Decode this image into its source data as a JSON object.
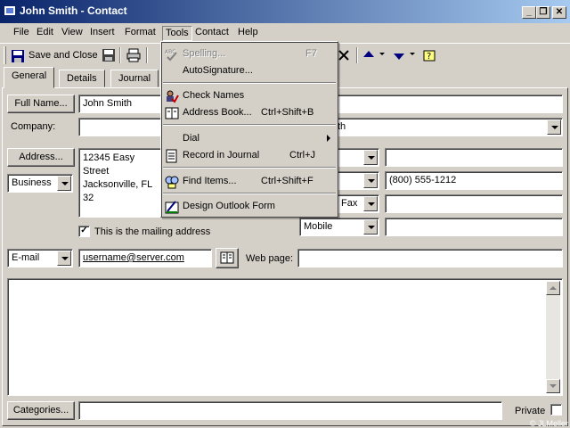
{
  "window": {
    "title": "John Smith - Contact",
    "controls": [
      "_",
      "❐",
      "✕"
    ]
  },
  "menubar": {
    "items": [
      {
        "label": "File",
        "key": "F"
      },
      {
        "label": "Edit",
        "key": "E"
      },
      {
        "label": "View",
        "key": "V"
      },
      {
        "label": "Insert",
        "key": "I"
      },
      {
        "label": "Format",
        "key": "o"
      },
      {
        "label": "Tools",
        "key": "T"
      },
      {
        "label": "Contact",
        "key": "C"
      },
      {
        "label": "Help",
        "key": "H"
      }
    ]
  },
  "toolbar": {
    "save_close_label": "Save and Close",
    "icons": [
      "save-icon",
      "print-icon",
      "delete-icon",
      "previous-item-icon",
      "next-item-icon",
      "address-book-icon"
    ]
  },
  "tabs": [
    "General",
    "Details",
    "Journal"
  ],
  "form": {
    "full_name_button": "Full Name...",
    "full_name_value": "John Smith",
    "company_label": "Company:",
    "file_as_partial": "th",
    "address_button": "Address...",
    "address_type": "Business",
    "address_lines": [
      "12345 Easy Street",
      "Jacksonville, FL  32"
    ],
    "mailing_checkbox_label": "This is the mailing address",
    "mailing_checked": true,
    "phones": [
      {
        "type": "",
        "value": ""
      },
      {
        "type": "",
        "value": "(800) 555-1212"
      },
      {
        "type": "Fax",
        "value": ""
      },
      {
        "type": "Mobile",
        "value": ""
      }
    ],
    "email_type": "E-mail",
    "email_value": "username@server.com",
    "webpage_label": "Web page:",
    "webpage_value": "",
    "categories_button": "Categories...",
    "categories_value": "",
    "private_label": "Private",
    "private_checked": false
  },
  "tools_menu": {
    "items": [
      {
        "label": "Spelling...",
        "shortcut": "F7",
        "disabled": true,
        "icon": "spelling-icon"
      },
      {
        "label": "AutoSignature...",
        "shortcut": "",
        "disabled": false,
        "icon": ""
      },
      {
        "label": "Check Names",
        "shortcut": "",
        "disabled": false,
        "icon": "check-names-icon"
      },
      {
        "label": "Address Book...",
        "shortcut": "Ctrl+Shift+B",
        "disabled": false,
        "icon": "address-book-icon"
      },
      {
        "label": "Dial",
        "shortcut": "",
        "disabled": false,
        "icon": "",
        "submenu": true
      },
      {
        "label": "Record in Journal",
        "shortcut": "Ctrl+J",
        "disabled": false,
        "icon": "journal-icon"
      },
      {
        "label": "Find Items...",
        "shortcut": "Ctrl+Shift+F",
        "disabled": false,
        "icon": "find-icon"
      },
      {
        "label": "Design Outlook Form",
        "shortcut": "",
        "disabled": false,
        "icon": "design-form-icon"
      }
    ]
  },
  "copyright": "© JLMeller",
  "colors": {
    "titlebar_start": "#0a246a",
    "titlebar_end": "#a6caf0",
    "face": "#d4d0c8"
  }
}
